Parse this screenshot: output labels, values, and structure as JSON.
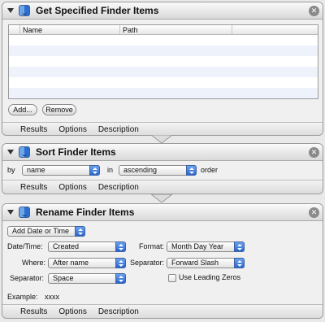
{
  "actions": {
    "get_items": {
      "title": "Get Specified Finder Items",
      "columns": [
        "Name",
        "Path"
      ],
      "rows": 7,
      "add_label": "Add...",
      "remove_label": "Remove",
      "tabs": [
        "Results",
        "Options",
        "Description"
      ]
    },
    "sort_items": {
      "title": "Sort Finder Items",
      "by_label": "by",
      "by_value": "name",
      "in_label": "in",
      "order_value": "ascending",
      "order_label": "order",
      "tabs": [
        "Results",
        "Options",
        "Description"
      ]
    },
    "rename_items": {
      "title": "Rename Finder Items",
      "mode_value": "Add Date or Time",
      "datetime_label": "Date/Time:",
      "datetime_value": "Created",
      "format_label": "Format:",
      "format_value": "Month Day Year",
      "where_label": "Where:",
      "where_value": "After name",
      "separator_label": "Separator:",
      "separator_value": "Forward Slash",
      "separator2_label": "Separator:",
      "separator2_value": "Space",
      "leading_zeros_label": "Use Leading Zeros",
      "leading_zeros_checked": false,
      "example_label": "Example:",
      "example_value": "xxxx",
      "tabs": [
        "Results",
        "Options",
        "Description"
      ]
    }
  },
  "colors": {
    "accent_blue": "#2a66cf",
    "table_stripe": "#eef3fb"
  }
}
